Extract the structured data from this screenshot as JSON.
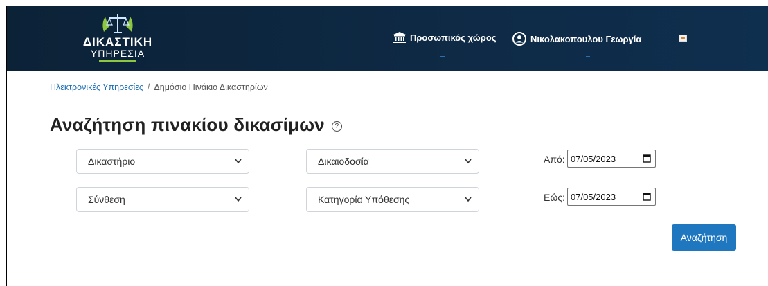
{
  "header": {
    "logo": {
      "line1": "ΔΙΚΑΣΤΙΚΗ",
      "line2": "ΥΠΗΡΕΣΙΑ"
    },
    "personal_space_label": "Προσωπικός χώρος",
    "user_name": "Νικολακοπουλου Γεωργία"
  },
  "breadcrumb": {
    "items": [
      "Ηλεκτρονικές Υπηρεσίες",
      "Δημόσιο Πινάκιο Δικαστηρίων"
    ],
    "separator": "/"
  },
  "page": {
    "title": "Αναζήτηση πινακίου δικασίμων"
  },
  "filters": {
    "court": "Δικαστήριο",
    "jurisdiction": "Δικαιοδοσία",
    "composition": "Σύνθεση",
    "case_category": "Κατηγορία Υπόθεσης",
    "from_label": "Από:",
    "from_value": "07/05/2023",
    "to_label": "Εώς:",
    "to_value": "07/05/2023"
  },
  "actions": {
    "search_label": "Αναζήτηση"
  },
  "colors": {
    "header_bg": "#0c2237",
    "accent": "#1f77c0",
    "link": "#1f6fb5"
  }
}
